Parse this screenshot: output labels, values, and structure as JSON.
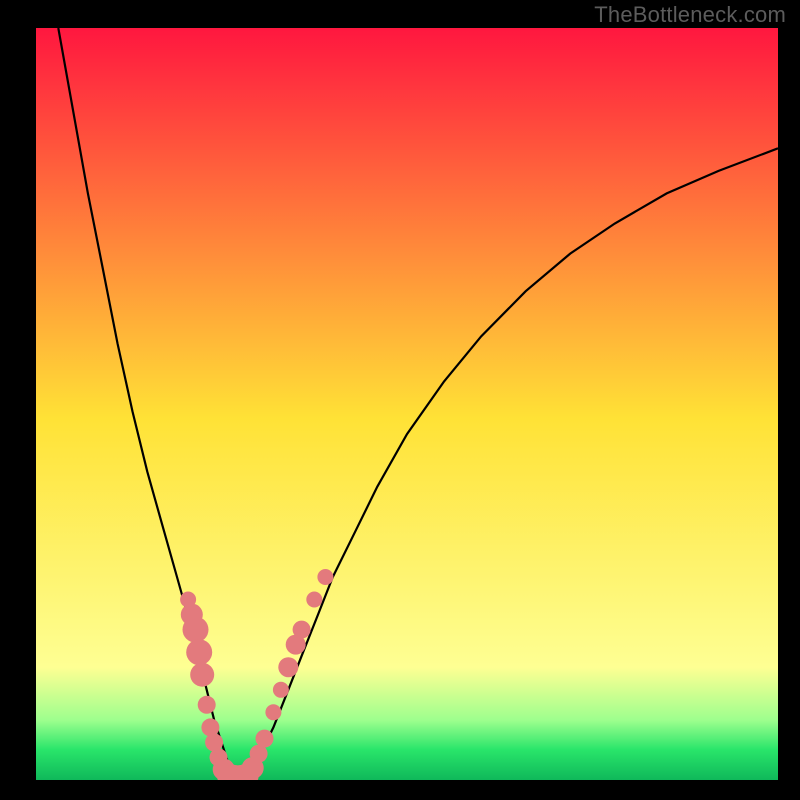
{
  "watermark": "TheBottleneck.com",
  "colors": {
    "bg": "#000000",
    "curve": "#000000",
    "marker_fill": "#e37a7d",
    "marker_stroke": "#c85a5d",
    "grad_top": "#ff173f",
    "grad_mid": "#ffe236",
    "grad_low": "#feff93",
    "grad_green1": "#9eff8e",
    "grad_green2": "#29e56a",
    "grad_green3": "#0fb85a"
  },
  "chart_data": {
    "type": "line",
    "title": "",
    "xlabel": "",
    "ylabel": "",
    "xlim": [
      0,
      100
    ],
    "ylim": [
      0,
      100
    ],
    "series": [
      {
        "name": "bottleneck-curve",
        "x": [
          3,
          5,
          7,
          9,
          11,
          13,
          15,
          17,
          19,
          21,
          22,
          23,
          24,
          25,
          26,
          27,
          28,
          29,
          30,
          32,
          34,
          36,
          38,
          40,
          43,
          46,
          50,
          55,
          60,
          66,
          72,
          78,
          85,
          92,
          100
        ],
        "y": [
          100,
          89,
          78,
          68,
          58,
          49,
          41,
          34,
          27,
          20,
          16,
          12,
          8,
          5,
          2,
          0,
          0,
          1,
          3,
          7,
          12,
          17,
          22,
          27,
          33,
          39,
          46,
          53,
          59,
          65,
          70,
          74,
          78,
          81,
          84
        ]
      }
    ],
    "markers": {
      "name": "highlight-dots",
      "points": [
        {
          "x": 20.5,
          "y": 24,
          "r": 1.6
        },
        {
          "x": 21.0,
          "y": 22,
          "r": 2.2
        },
        {
          "x": 21.5,
          "y": 20,
          "r": 2.6
        },
        {
          "x": 22.0,
          "y": 17,
          "r": 2.6
        },
        {
          "x": 22.4,
          "y": 14,
          "r": 2.4
        },
        {
          "x": 23.0,
          "y": 10,
          "r": 1.8
        },
        {
          "x": 23.5,
          "y": 7,
          "r": 1.8
        },
        {
          "x": 24.0,
          "y": 5,
          "r": 1.8
        },
        {
          "x": 24.6,
          "y": 3,
          "r": 1.8
        },
        {
          "x": 25.3,
          "y": 1.4,
          "r": 2.2
        },
        {
          "x": 26.0,
          "y": 0.6,
          "r": 2.4
        },
        {
          "x": 26.8,
          "y": 0.4,
          "r": 2.4
        },
        {
          "x": 27.6,
          "y": 0.4,
          "r": 2.4
        },
        {
          "x": 28.4,
          "y": 0.6,
          "r": 2.4
        },
        {
          "x": 29.2,
          "y": 1.6,
          "r": 2.2
        },
        {
          "x": 30.0,
          "y": 3.5,
          "r": 1.8
        },
        {
          "x": 30.8,
          "y": 5.5,
          "r": 1.8
        },
        {
          "x": 32.0,
          "y": 9,
          "r": 1.6
        },
        {
          "x": 33.0,
          "y": 12,
          "r": 1.6
        },
        {
          "x": 34.0,
          "y": 15,
          "r": 2.0
        },
        {
          "x": 35.0,
          "y": 18,
          "r": 2.0
        },
        {
          "x": 35.8,
          "y": 20,
          "r": 1.8
        },
        {
          "x": 37.5,
          "y": 24,
          "r": 1.6
        },
        {
          "x": 39.0,
          "y": 27,
          "r": 1.6
        }
      ]
    }
  }
}
